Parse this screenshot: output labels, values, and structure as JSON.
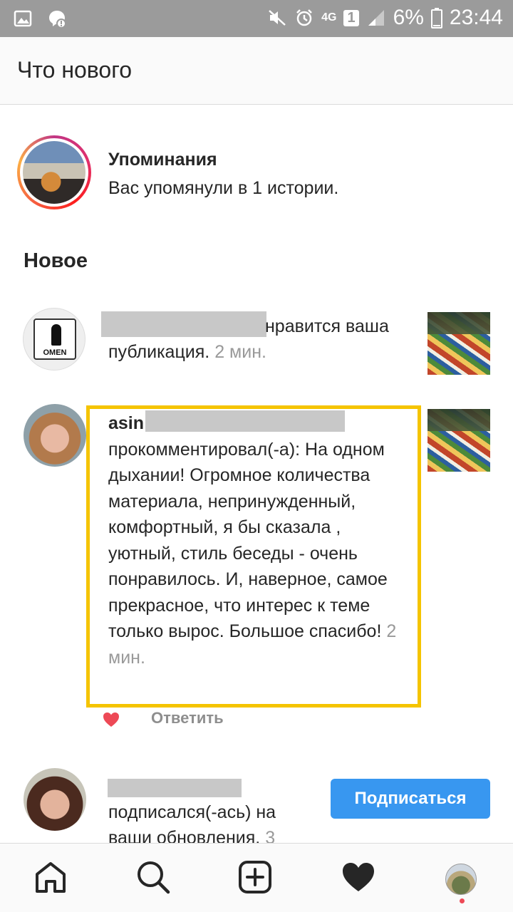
{
  "status_bar": {
    "network": "4G",
    "sim": "1",
    "battery": "6%",
    "time": "23:44"
  },
  "header": {
    "title": "Что нового"
  },
  "mentions": {
    "title": "Упоминания",
    "text": "Вас упомянули в 1 истории."
  },
  "section": {
    "title": "Новое"
  },
  "notifications": [
    {
      "line1_suffix": "нравится ваша",
      "line2": "публикация.",
      "time": "2 мин.",
      "avatar_caption": "OMEN"
    },
    {
      "username_prefix": "asin",
      "text": "прокомментировал(-а): На одном дыхании! Огромное количества материала, непринужденный, комфортный, я бы сказала , уютный, стиль беседы - очень понравилось. И, наверное, самое прекрасное, что интерес к теме только вырос. Большое спасибо!",
      "time": "2 мин.",
      "reply_label": "Ответить",
      "highlight_color": "#f5c400"
    },
    {
      "text": "подписался(-ась) на ваши обновления.",
      "time": "3",
      "follow_label": "Подписаться",
      "button_color": "#3897f0"
    }
  ],
  "colors": {
    "status_bar": "#9b9b9b",
    "like_heart": "#ed4956",
    "notification_dot": "#ed4956"
  },
  "icons": [
    "image-icon",
    "messenger-icon",
    "mute-icon",
    "alarm-icon",
    "signal-icon",
    "battery-icon",
    "heart-icon",
    "home-icon",
    "search-icon",
    "add-icon",
    "activity-heart-icon",
    "profile-avatar"
  ]
}
